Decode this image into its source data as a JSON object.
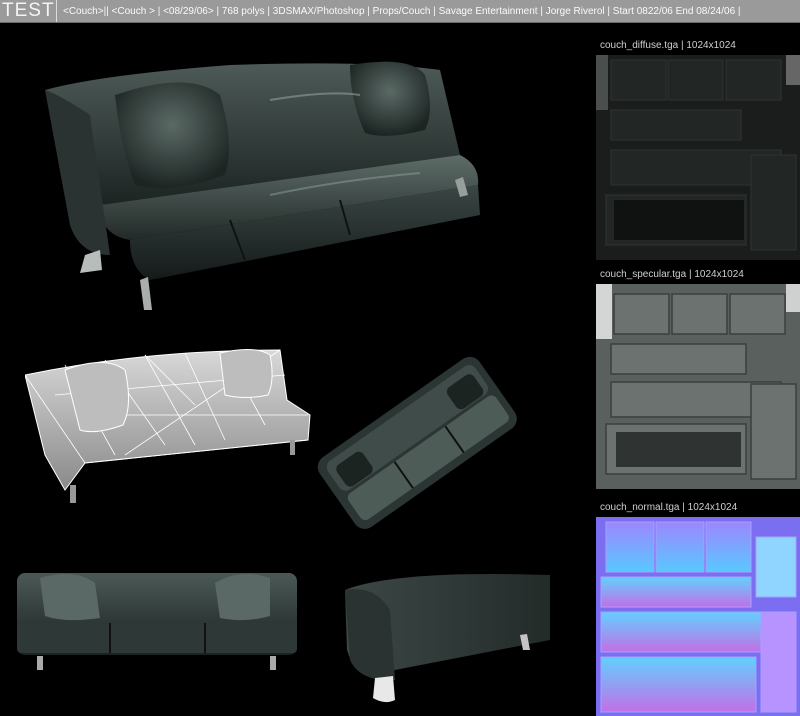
{
  "header": {
    "badge": "TEST",
    "info": "<Couch>|| <Couch > | <08/29/06> | 768 polys | 3DSMAX/Photoshop | Props/Couch | Savage Entertainment  | Jorge Riverol | Start 0822/06 End 08/24/06 |"
  },
  "textures": [
    {
      "label": "couch_diffuse.tga | 1024x1024"
    },
    {
      "label": "couch_specular.tga | 1024x1024"
    },
    {
      "label": "couch_normal.tga | 1024x1024"
    }
  ],
  "colors": {
    "header_bg": "#9a9a9a",
    "leather_dark": "#1c2422",
    "leather_mid": "#3a4744",
    "leather_light": "#6f807b",
    "diffuse_bg": "#1a1d1c",
    "specular_bg": "#5a605e",
    "normal_bg": "#7b6ef0"
  }
}
